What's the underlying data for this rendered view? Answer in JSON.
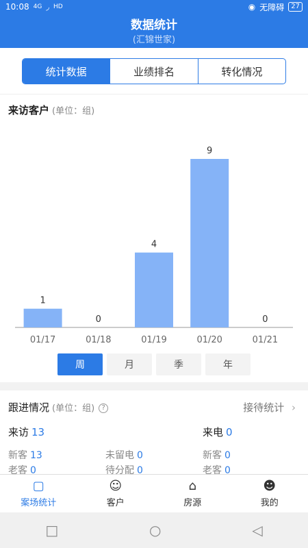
{
  "status": {
    "time": "10:08",
    "signal": "4G",
    "hd": "HD",
    "accessibility": "无障碍",
    "battery": "27"
  },
  "header": {
    "title": "数据统计",
    "subtitle": "(汇锦世家)"
  },
  "tabs": [
    {
      "label": "统计数据",
      "active": true
    },
    {
      "label": "业绩排名",
      "active": false
    },
    {
      "label": "转化情况",
      "active": false
    }
  ],
  "section": {
    "title": "来访客户",
    "unit": "(单位：组)"
  },
  "chart_data": {
    "type": "bar",
    "categories": [
      "01/17",
      "01/18",
      "01/19",
      "01/20",
      "01/21"
    ],
    "values": [
      1,
      0,
      4,
      9,
      0
    ],
    "bar_color": "#85b3f7",
    "ylim": [
      0,
      9
    ]
  },
  "period": [
    {
      "label": "周",
      "active": true
    },
    {
      "label": "月",
      "active": false
    },
    {
      "label": "季",
      "active": false
    },
    {
      "label": "年",
      "active": false
    }
  ],
  "follow": {
    "title": "跟进情况",
    "unit": "(单位：组)",
    "help_icon": "?",
    "link": "接待统计",
    "visit_label": "来访",
    "visit_value": "13",
    "call_label": "来电",
    "call_value": "0",
    "sub1_label": "新客",
    "sub1_value": "13",
    "sub2_label": "未留电",
    "sub2_value": "0",
    "sub3_label": "新客",
    "sub3_value": "0",
    "sub4_label": "老客",
    "sub4_value": "0",
    "sub5_label": "待分配",
    "sub5_value": "0",
    "sub6_label": "老客",
    "sub6_value": "0"
  },
  "nav": [
    {
      "label": "案场统计",
      "icon": "monitor-icon",
      "active": true
    },
    {
      "label": "客户",
      "icon": "smile-icon",
      "active": false
    },
    {
      "label": "房源",
      "icon": "house-icon",
      "active": false
    },
    {
      "label": "我的",
      "icon": "user-icon",
      "active": false
    }
  ],
  "accent": "#2c7be5"
}
